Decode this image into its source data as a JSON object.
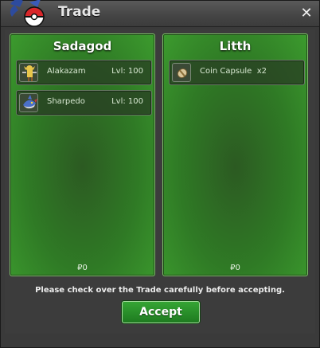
{
  "window": {
    "title": "Trade",
    "close_label": "✕"
  },
  "left_panel": {
    "player": "Sadagod",
    "items": [
      {
        "name": "Alakazam",
        "level": "Lvl: 100",
        "icon": "alakazam-sprite-icon"
      },
      {
        "name": "Sharpedo",
        "level": "Lvl: 100",
        "icon": "sharpedo-sprite-icon"
      }
    ],
    "money": "₽0"
  },
  "right_panel": {
    "player": "Litth",
    "items": [
      {
        "name": "Coin Capsule  x2",
        "icon": "coin-capsule-icon"
      }
    ],
    "money": "₽0"
  },
  "footer": {
    "notice": "Please check over the Trade carefully before accepting.",
    "accept_label": "Accept"
  },
  "colors": {
    "panel_green": "#2f7a25",
    "accept_green": "#2a8f2a",
    "window_grey": "#3a3a3a"
  }
}
